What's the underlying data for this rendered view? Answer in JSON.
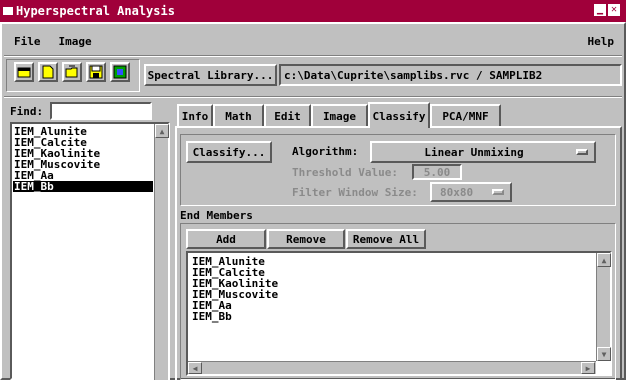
{
  "window": {
    "title": "Hyperspectral Analysis"
  },
  "menu": {
    "file": "File",
    "image": "Image",
    "help": "Help"
  },
  "toolbar": {
    "icons": [
      "open-icon",
      "new-icon",
      "open-folder-icon",
      "save-icon",
      "image-icon"
    ],
    "spectral_library_label": "Spectral Library...",
    "library_path": "c:\\Data\\Cuprite\\samplibs.rvc / SAMPLIB2"
  },
  "find": {
    "label": "Find:",
    "value": ""
  },
  "members_list": [
    {
      "label": "IEM_Alunite",
      "selected": false
    },
    {
      "label": "IEM_Calcite",
      "selected": false
    },
    {
      "label": "IEM_Kaolinite",
      "selected": false
    },
    {
      "label": "IEM_Muscovite",
      "selected": false
    },
    {
      "label": "IEM_Aa",
      "selected": false
    },
    {
      "label": "IEM_Bb",
      "selected": true
    }
  ],
  "tabs": [
    "Info",
    "Math",
    "Edit",
    "Image",
    "Classify",
    "PCA/MNF"
  ],
  "active_tab": "Classify",
  "classify": {
    "button_label": "Classify...",
    "algorithm_label": "Algorithm:",
    "algorithm_value": "Linear Unmixing",
    "threshold_label": "Threshold Value:",
    "threshold_value": "5.00",
    "filter_label": "Filter Window Size:",
    "filter_value": "80x80"
  },
  "end_members": {
    "label": "End Members",
    "add_label": "Add",
    "remove_label": "Remove",
    "remove_all_label": "Remove All",
    "items": [
      "IEM_Alunite",
      "IEM_Calcite",
      "IEM_Kaolinite",
      "IEM_Muscovite",
      "IEM_Aa",
      "IEM_Bb"
    ]
  },
  "colors": {
    "titlebar": "#a0003a",
    "face": "#c0c0c0",
    "disabled": "#8a8a8a"
  }
}
